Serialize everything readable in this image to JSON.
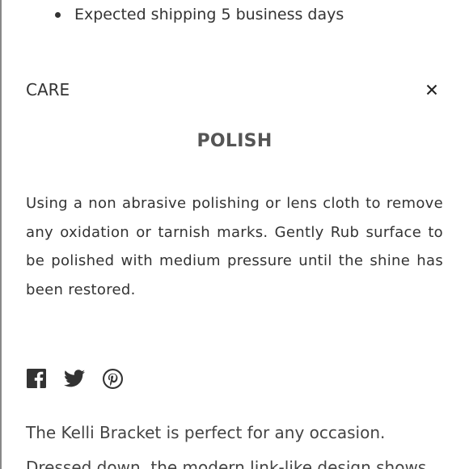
{
  "shipping": {
    "item": "Expected shipping 5 business days"
  },
  "care": {
    "label": "CARE",
    "close_icon": "close-icon"
  },
  "polish": {
    "title": "POLISH",
    "body": "Using a non abrasive polishing or lens cloth to remove any oxidation or tarnish marks. Gently Rub surface to be polished with medium pressure until the shine has been restored."
  },
  "share": {
    "icons": [
      "facebook-icon",
      "twitter-icon",
      "pinterest-icon"
    ]
  },
  "description": {
    "line1": "The Kelli Bracket is perfect for any occasion.",
    "line2": "Dressed down, the modern link-like design shows"
  },
  "colors": {
    "text": "#333333",
    "title": "#555555"
  }
}
